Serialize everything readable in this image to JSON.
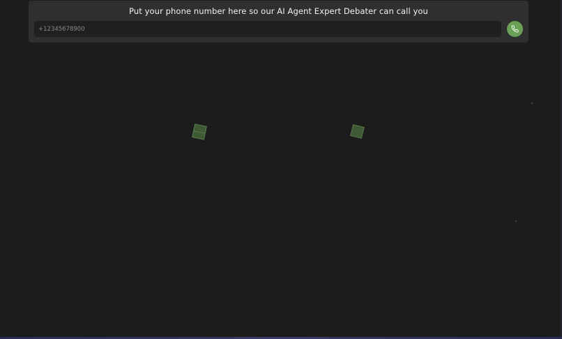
{
  "call_form": {
    "title": "Put your phone number here so our AI Agent Expert Debater can call you",
    "phone_input": {
      "value": "",
      "placeholder": "+12345678900"
    },
    "call_button": {
      "icon": "phone-icon"
    }
  },
  "colors": {
    "background": "#1c1c1c",
    "card": "#2f2f2f",
    "input": "#202020",
    "accent": "#6aa156"
  }
}
